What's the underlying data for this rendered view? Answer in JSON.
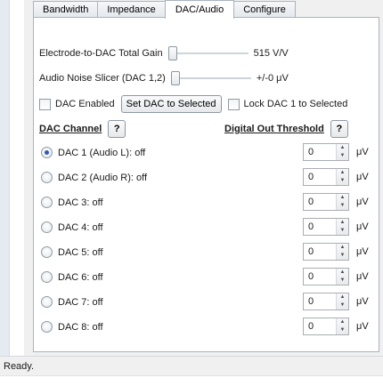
{
  "tabs": [
    {
      "label": "Bandwidth",
      "active": false
    },
    {
      "label": "Impedance",
      "active": false
    },
    {
      "label": "DAC/Audio",
      "active": true
    },
    {
      "label": "Configure",
      "active": false
    }
  ],
  "gain": {
    "label": "Electrode-to-DAC Total Gain",
    "value": "515 V/V"
  },
  "noise_slicer": {
    "label": "Audio Noise Slicer (DAC 1,2)",
    "value": "+/-0 μV"
  },
  "controls": {
    "dac_enabled_label": "DAC Enabled",
    "set_dac_button": "Set DAC to Selected",
    "lock_dac_label": "Lock DAC 1 to Selected"
  },
  "headers": {
    "dac_channel": "DAC Channel",
    "threshold": "Digital Out Threshold",
    "help": "?"
  },
  "channels": [
    {
      "label": "DAC 1 (Audio L): off",
      "threshold": "0",
      "unit": "μV",
      "selected": true
    },
    {
      "label": "DAC 2 (Audio R): off",
      "threshold": "0",
      "unit": "μV",
      "selected": false
    },
    {
      "label": "DAC 3: off",
      "threshold": "0",
      "unit": "μV",
      "selected": false
    },
    {
      "label": "DAC 4: off",
      "threshold": "0",
      "unit": "μV",
      "selected": false
    },
    {
      "label": "DAC 5: off",
      "threshold": "0",
      "unit": "μV",
      "selected": false
    },
    {
      "label": "DAC 6: off",
      "threshold": "0",
      "unit": "μV",
      "selected": false
    },
    {
      "label": "DAC 7: off",
      "threshold": "0",
      "unit": "μV",
      "selected": false
    },
    {
      "label": "DAC 8: off",
      "threshold": "0",
      "unit": "μV",
      "selected": false
    }
  ],
  "status": {
    "text": "Ready."
  }
}
